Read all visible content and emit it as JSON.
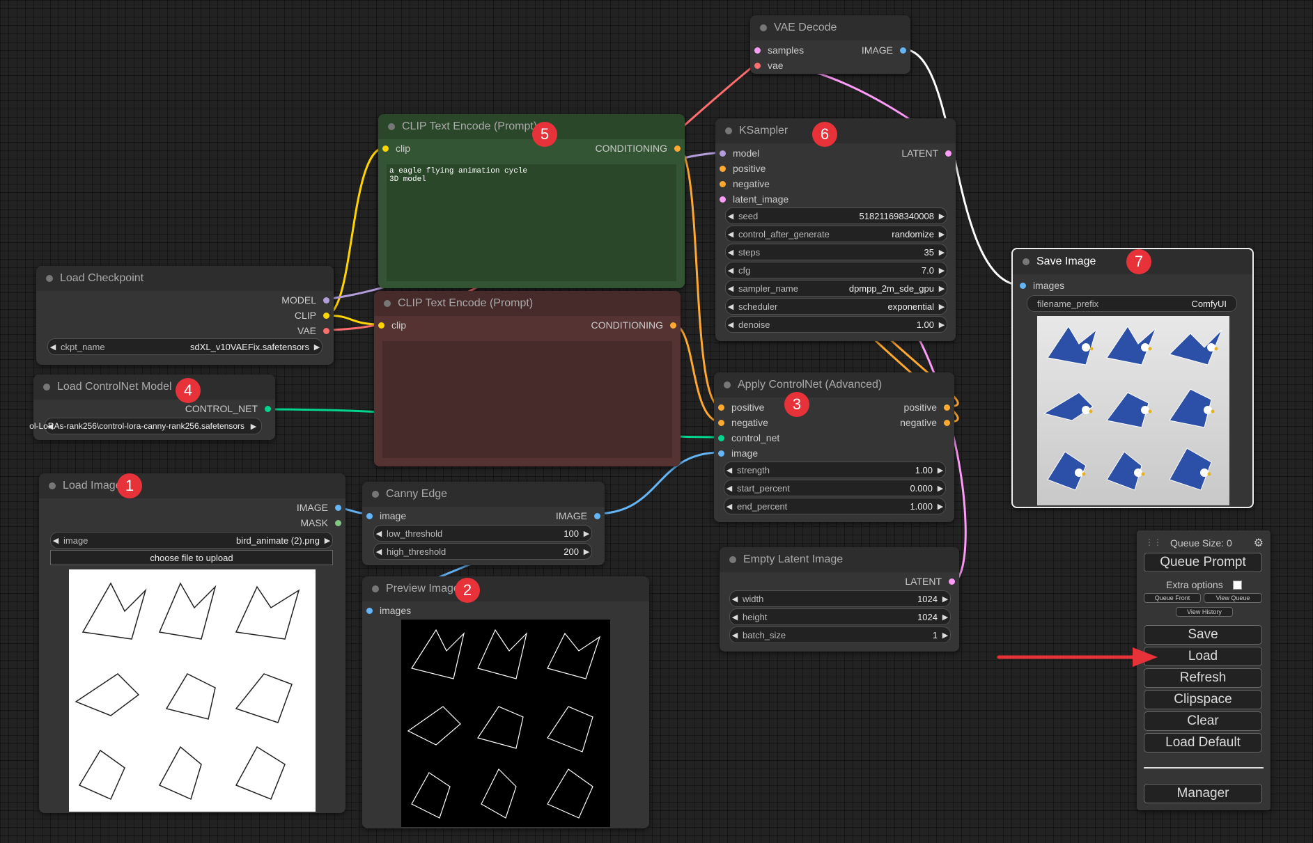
{
  "nodes": {
    "vae_decode": {
      "title": "VAE Decode",
      "in_samples": "samples",
      "in_vae": "vae",
      "out_image": "IMAGE"
    },
    "clip_pos": {
      "title": "CLIP Text Encode (Prompt)",
      "in_clip": "clip",
      "out": "CONDITIONING",
      "text": "a eagle flying animation cycle\n3D model"
    },
    "clip_neg": {
      "title": "CLIP Text Encode (Prompt)",
      "in_clip": "clip",
      "out": "CONDITIONING"
    },
    "ksampler": {
      "title": "KSampler",
      "in_model": "model",
      "in_positive": "positive",
      "in_negative": "negative",
      "in_latent": "latent_image",
      "out": "LATENT",
      "widgets": [
        {
          "label": "seed",
          "value": "518211698340008"
        },
        {
          "label": "control_after_generate",
          "value": "randomize"
        },
        {
          "label": "steps",
          "value": "35"
        },
        {
          "label": "cfg",
          "value": "7.0"
        },
        {
          "label": "sampler_name",
          "value": "dpmpp_2m_sde_gpu"
        },
        {
          "label": "scheduler",
          "value": "exponential"
        },
        {
          "label": "denoise",
          "value": "1.00"
        }
      ]
    },
    "save_image": {
      "title": "Save Image",
      "in_images": "images",
      "widget_label": "filename_prefix",
      "widget_value": "ComfyUI"
    },
    "load_checkpoint": {
      "title": "Load Checkpoint",
      "out_model": "MODEL",
      "out_clip": "CLIP",
      "out_vae": "VAE",
      "widget_label": "ckpt_name",
      "widget_value": "sdXL_v10VAEFix.safetensors"
    },
    "load_controlnet": {
      "title": "Load ControlNet Model",
      "out": "CONTROL_NET",
      "widget_value": "ol-LoRAs-rank256\\control-lora-canny-rank256.safetensors"
    },
    "apply_controlnet": {
      "title": "Apply ControlNet (Advanced)",
      "in_positive": "positive",
      "in_negative": "negative",
      "in_control_net": "control_net",
      "in_image": "image",
      "out_positive": "positive",
      "out_negative": "negative",
      "widgets": [
        {
          "label": "strength",
          "value": "1.00"
        },
        {
          "label": "start_percent",
          "value": "0.000"
        },
        {
          "label": "end_percent",
          "value": "1.000"
        }
      ]
    },
    "load_image": {
      "title": "Load Image",
      "out_image": "IMAGE",
      "out_mask": "MASK",
      "widget_label": "image",
      "widget_value": "bird_animate (2).png",
      "upload": "choose file to upload"
    },
    "canny": {
      "title": "Canny Edge",
      "in_image": "image",
      "out_image": "IMAGE",
      "widgets": [
        {
          "label": "low_threshold",
          "value": "100"
        },
        {
          "label": "high_threshold",
          "value": "200"
        }
      ]
    },
    "preview": {
      "title": "Preview Image",
      "in_images": "images"
    },
    "empty_latent": {
      "title": "Empty Latent Image",
      "out": "LATENT",
      "widgets": [
        {
          "label": "width",
          "value": "1024"
        },
        {
          "label": "height",
          "value": "1024"
        },
        {
          "label": "batch_size",
          "value": "1"
        }
      ]
    }
  },
  "badges": [
    "1",
    "2",
    "3",
    "4",
    "5",
    "6",
    "7"
  ],
  "menu": {
    "queue_size": "Queue Size: 0",
    "queue_prompt": "Queue Prompt",
    "extra_options": "Extra options",
    "queue_front": "Queue Front",
    "view_queue": "View Queue",
    "view_history": "View History",
    "save": "Save",
    "load": "Load",
    "refresh": "Refresh",
    "clipspace": "Clipspace",
    "clear": "Clear",
    "load_default": "Load Default",
    "manager": "Manager"
  },
  "colors": {
    "clip": "#ffd500",
    "model": "#b39ddb",
    "vae": "#ff6e6e",
    "conditioning": "#ffa931",
    "latent": "#ff9cf9",
    "image": "#64b5f6",
    "mask": "#81c784",
    "control_net": "#00d78d",
    "clip_pos_node": "#335533",
    "clip_neg_node": "#553333",
    "badge": "#e8323a"
  }
}
